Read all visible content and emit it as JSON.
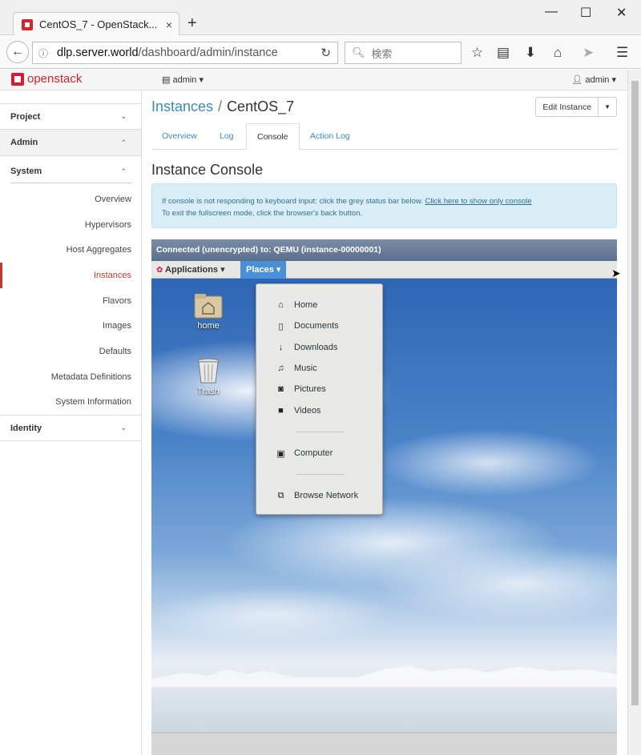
{
  "browser": {
    "tab_title": "CentOS_7 - OpenStack...",
    "tab_close": "×",
    "new_tab": "+",
    "url_host": "dlp.server.world",
    "url_path": "/dashboard/admin/instance",
    "search_placeholder": "検索"
  },
  "header": {
    "logo": "openstack",
    "project": "admin ▾",
    "user": "admin ▾"
  },
  "sidebar": {
    "project": "Project",
    "admin": "Admin",
    "system": "System",
    "items": [
      "Overview",
      "Hypervisors",
      "Host Aggregates",
      "Instances",
      "Flavors",
      "Images",
      "Defaults",
      "Metadata Definitions",
      "System Information"
    ],
    "identity": "Identity"
  },
  "main": {
    "crumb_link": "Instances",
    "crumb_sep": "/",
    "crumb_current": "CentOS_7",
    "edit_button": "Edit Instance",
    "tabs": [
      "Overview",
      "Log",
      "Console",
      "Action Log"
    ],
    "heading": "Instance Console",
    "alert_line1": "If console is not responding to keyboard input: click the grey status bar below.",
    "alert_link": "Click here to show only console",
    "alert_line2": "To exit the fullscreen mode, click the browser's back button."
  },
  "console": {
    "status": "Connected (unencrypted) to: QEMU (instance-00000001)",
    "applications": "Applications ▾",
    "places": "Places ▾",
    "desktop_icons": [
      "home",
      "Trash"
    ],
    "menu": [
      "Home",
      "Documents",
      "Downloads",
      "Music",
      "Pictures",
      "Videos",
      "Computer",
      "Browse Network"
    ]
  }
}
